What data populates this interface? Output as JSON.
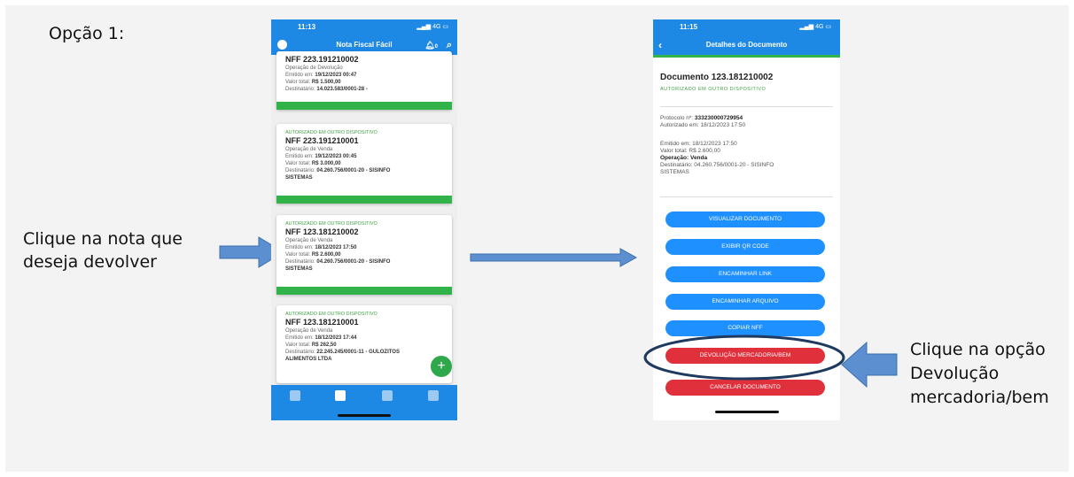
{
  "captions": {
    "option": "Opção 1:",
    "left_line1": "Clique na nota que",
    "left_line2": "deseja devolver",
    "right_line1": "Clique na opção",
    "right_line2": "Devolução",
    "right_line3": "mercadoria/bem"
  },
  "phone1": {
    "time": "11:13",
    "signal": "4G",
    "title": "Nota Fiscal Fácil",
    "notification_count": "0",
    "cards": [
      {
        "status": "",
        "title": "NFF 223.191210002",
        "operation": "Operação de Devolução",
        "emitted_label": "Emitido em:",
        "emitted": "19/12/2023 00:47",
        "value_label": "Valor total:",
        "value": "R$ 1.500,00",
        "dest_label": "Destinatário:",
        "dest": "14.023.583/0001-28 -",
        "dest2": ""
      },
      {
        "status": "AUTORIZADO EM OUTRO DISPOSITIVO",
        "title": "NFF 223.191210001",
        "operation": "Operação de Venda",
        "emitted_label": "Emitido em:",
        "emitted": "19/12/2023 00:45",
        "value_label": "Valor total:",
        "value": "R$ 3.000,00",
        "dest_label": "Destinatário:",
        "dest": "04.260.756/0001-20 - SISINFO",
        "dest2": "SISTEMAS"
      },
      {
        "status": "AUTORIZADO EM OUTRO DISPOSITIVO",
        "title": "NFF 123.181210002",
        "operation": "Operação de Venda",
        "emitted_label": "Emitido em:",
        "emitted": "18/12/2023 17:50",
        "value_label": "Valor total:",
        "value": "R$ 2.600,00",
        "dest_label": "Destinatário:",
        "dest": "04.260.756/0001-20 - SISINFO",
        "dest2": "SISTEMAS"
      },
      {
        "status": "AUTORIZADO EM OUTRO DISPOSITIVO",
        "title": "NFF 123.181210001",
        "operation": "Operação de Venda",
        "emitted_label": "Emitido em:",
        "emitted": "18/12/2023 17:44",
        "value_label": "Valor total:",
        "value": "R$ 262,50",
        "dest_label": "Destinatário:",
        "dest": "22.245.245/0001-11 - GULOZITOS",
        "dest2": "ALIMENTOS LTDA"
      }
    ],
    "fab": "+"
  },
  "phone2": {
    "time": "11:15",
    "signal": "4G",
    "title": "Detalhes do Documento",
    "doc_title": "Documento 123.181210002",
    "doc_status": "AUTORIZADO EM OUTRO DISPOSITIVO",
    "protocol_label": "Protocolo nº:",
    "protocol": "333230000729954",
    "authorized": "Autorizado em: 18/12/2023 17:50",
    "emitted": "Emitido em: 18/12/2023 17:50",
    "value": "Valor total: R$ 2.600,00",
    "operation_label": "Operação:",
    "operation": "Venda",
    "dest": "Destinatário: 04.260.756/0001-20 - SISINFO",
    "dest2": "SISTEMAS",
    "buttons": [
      "VISUALIZAR DOCUMENTO",
      "EXIBIR QR CODE",
      "ENCAMINHAR LINK",
      "ENCAMINHAR ARQUIVO",
      "COPIAR NFF",
      "DEVOLUÇÃO MERCADORIA/BEM",
      "CANCELAR DOCUMENTO"
    ]
  },
  "colors": {
    "appbar": "#1e88e5",
    "green": "#32b34a",
    "blue_button": "#1e90ff",
    "red_button": "#e0303c",
    "arrow": "#5b8fd0",
    "ellipse": "#1f3a5f"
  }
}
